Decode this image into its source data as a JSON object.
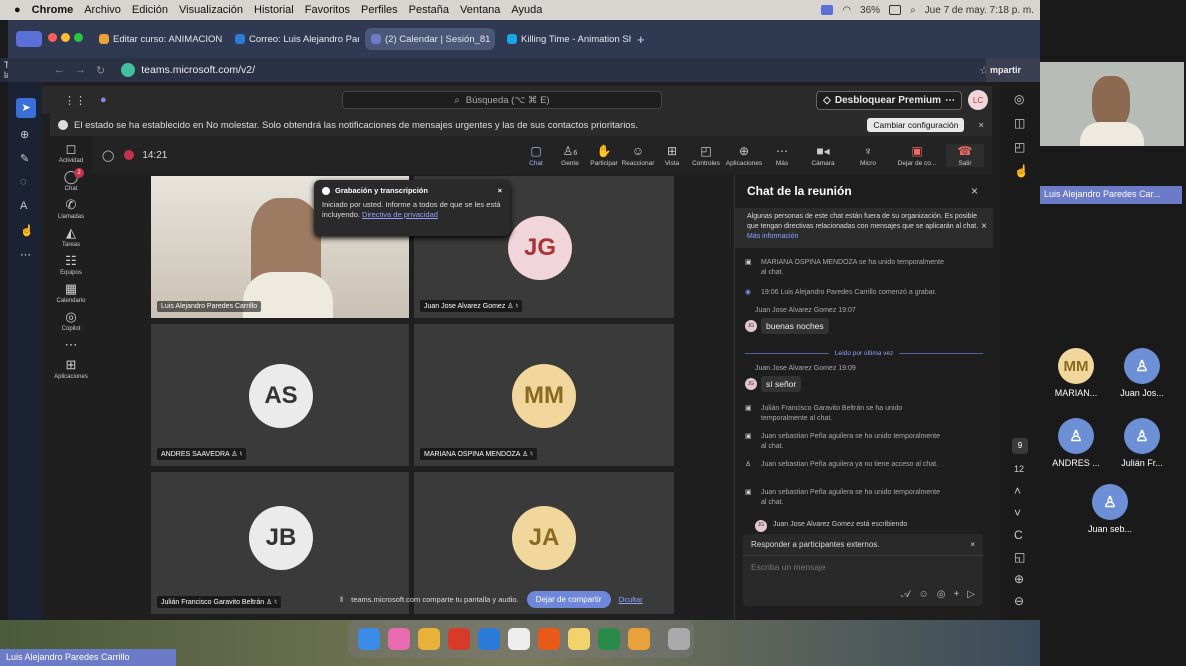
{
  "menubar": {
    "apple": "",
    "app": "Chrome",
    "items": [
      "Archivo",
      "Edición",
      "Visualización",
      "Historial",
      "Favoritos",
      "Perfiles",
      "Pestaña",
      "Ventana",
      "Ayuda"
    ],
    "battery": "36%",
    "datetime": "Jue 7 de may. 7:18 p. m."
  },
  "browser": {
    "tabs": [
      "Editar curso: ANIMACION DI",
      "Correo: Luis Alejandro Pared",
      "(2) Calendar | Sesión_81",
      "Killing Time - Animation Sho"
    ],
    "url": "teams.microsoft.com/v2/",
    "todas": "Todas las",
    "share_btn": "mpartir"
  },
  "teams": {
    "search": "Búsqueda (⌥ ⌘ E)",
    "premium": "Desbloquear Premium",
    "notice": "El estado se ha establecido en No molestar. Solo obtendrá las notificaciones de mensajes urgentes y las de sus contactos prioritarios.",
    "notice_btn": "Cambiar configuración",
    "avatar": "LC",
    "rail": [
      {
        "icon": "🔔",
        "label": "Actividad"
      },
      {
        "icon": "💬",
        "label": "Chat",
        "badge": "2"
      },
      {
        "icon": "📞",
        "label": "Llamadas"
      },
      {
        "icon": "🔔",
        "label": "Tareas"
      },
      {
        "icon": "👥",
        "label": "Equipos"
      },
      {
        "icon": "📅",
        "label": "Calendario"
      },
      {
        "icon": "◎",
        "label": "Copilot"
      },
      {
        "icon": "⋯",
        "label": ""
      },
      {
        "icon": "⊞",
        "label": "Aplicaciones"
      }
    ]
  },
  "meeting": {
    "timer": "14:21",
    "people_count": "6",
    "buttons": [
      "Chat",
      "Gente",
      "Participar",
      "Reaccionar",
      "Vista",
      "Controles",
      "Aplicaciones",
      "Más",
      "Cámara",
      "Micro",
      "Dejar de co...",
      "Salir"
    ]
  },
  "tiles": [
    {
      "initials": "",
      "name": "Luis Alejandro Paredes Carrillo"
    },
    {
      "initials": "JG",
      "name": "Juan Jose Alvarez Gomez",
      "color": "#f0d5da"
    },
    {
      "initials": "AS",
      "name": "ANDRES SAAVEDRA",
      "color": "#ebebeb"
    },
    {
      "initials": "MM",
      "name": "MARIANA OSPINA MENDOZA",
      "color": "#f2d79c"
    },
    {
      "initials": "JB",
      "name": "Julián Francisco Garavito Beltrán",
      "color": "#ebebeb"
    },
    {
      "initials": "JA",
      "name": "JA",
      "color": "#f2d79c"
    }
  ],
  "recording": {
    "title": "Grabación y transcripción",
    "body": "Iniciado por usted. Informe a todos de que se les está incluyendo.",
    "link": "Directiva de privacidad"
  },
  "sharebar": {
    "text": "teams.microsoft.com comparte tu pantalla y audio.",
    "stop": "Dejar de compartir",
    "hide": "Ocultar"
  },
  "chat": {
    "title": "Chat de la reunión",
    "warning": "Algunas personas de este chat están fuera de su organización. Es posible que tengan directivas relacionadas con mensajes que se aplicarán al chat.",
    "warning_link": "Más información",
    "events": [
      {
        "text": "MARIANA OSPINA MENDOZA se ha unido temporalmente al chat."
      },
      {
        "text": "19:06  Luis Alejandro Paredes Carrillo comenzó a grabar."
      },
      {
        "text": "Juan Jose Alvarez Gomez  19:07"
      }
    ],
    "msg1": "buenas noches",
    "msg1_av": "JG",
    "read_marker": "Leído por última vez",
    "meta2": "Juan Jose Alvarez Gomez  19:09",
    "msg2": "sí señor",
    "msg2_av": "JG",
    "events2": [
      "Julián Francisco Garavito Beltrán se ha unido temporalmente al chat.",
      "Juan sebastian Peña aguilera se ha unido temporalmente al chat.",
      "Juan sebastian Peña aguilera ya no tiene acceso al chat.",
      "Juan sebastian Peña aguilera se ha unido temporalmente al chat."
    ],
    "typing": "Juan Jose Alvarez Gomez está escribiendo",
    "typing_av": "JG",
    "reply_header": "Responder a participantes externos.",
    "placeholder": "Escriba un mensaje"
  },
  "rightpanel": {
    "self_name": "Luis Alejandro Paredes Car...",
    "badge": "9",
    "count": "12",
    "participants": [
      {
        "initials": "MM",
        "name": "MARIAN...",
        "color": "#f2d79c"
      },
      {
        "initials": "",
        "name": "Juan Jos...",
        "color": "#6c8fd6"
      },
      {
        "initials": "",
        "name": "ANDRES ...",
        "color": "#6c8fd6"
      },
      {
        "initials": "",
        "name": "Julián Fr...",
        "color": "#6c8fd6"
      },
      {
        "initials": "",
        "name": "Juan seb...",
        "color": "#6c8fd6"
      }
    ]
  },
  "bottom": {
    "name": "Luis Alejandro Paredes Carrillo"
  }
}
